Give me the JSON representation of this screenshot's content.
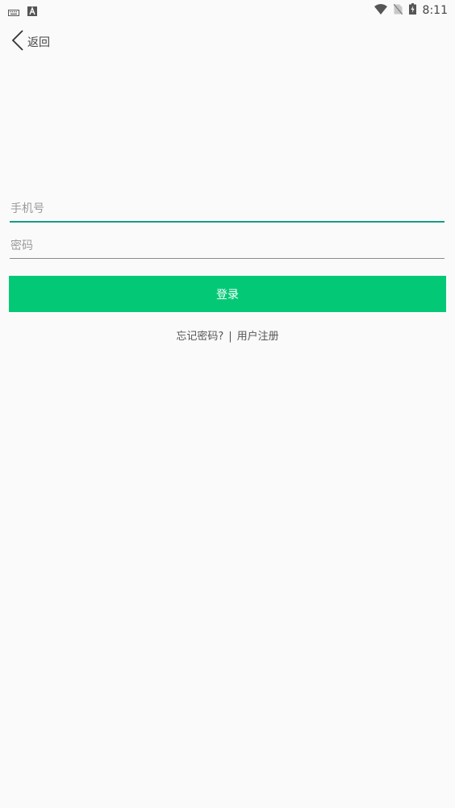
{
  "status_bar": {
    "time": "8:11",
    "icons": [
      "keyboard-icon",
      "a-badge-icon",
      "wifi-icon",
      "no-sim-icon",
      "battery-charging-icon"
    ]
  },
  "header": {
    "back_label": "返回"
  },
  "form": {
    "phone_placeholder": "手机号",
    "phone_value": "",
    "password_placeholder": "密码",
    "password_value": "",
    "login_label": "登录"
  },
  "links": {
    "forgot_password": "忘记密码?",
    "separator": "|",
    "register": "用户注册"
  },
  "colors": {
    "accent": "#03c976",
    "focus_underline": "#199a86",
    "background": "#fafafa"
  }
}
